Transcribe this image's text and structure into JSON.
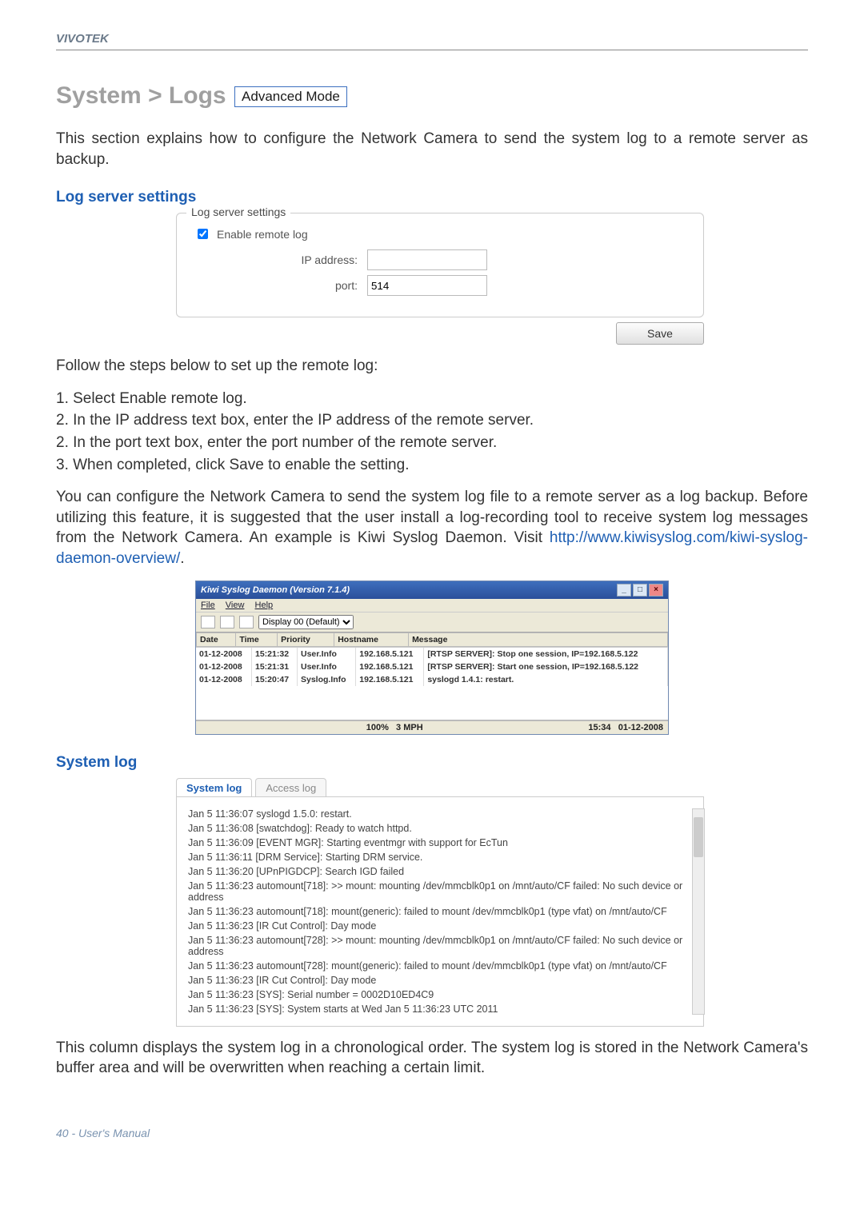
{
  "brand": "VIVOTEK",
  "heading": "System > Logs",
  "advanced_badge": "Advanced Mode",
  "intro_para": "This section explains how to configure the Network Camera to send the system log to a remote server as backup.",
  "section_log_server": "Log server settings",
  "panel": {
    "legend": "Log server settings",
    "enable_label": "Enable remote log",
    "ip_label": "IP address:",
    "ip_value": "",
    "port_label": "port:",
    "port_value": "514",
    "save_label": "Save"
  },
  "steps_intro": "Follow the steps below to set up the remote log:",
  "steps": [
    "1. Select Enable remote log.",
    "2. In the IP address text box, enter the IP address of the remote server.",
    "2. In the port text box, enter the port number of the remote server.",
    "3. When completed, click Save to enable the setting."
  ],
  "backup_para_pre": "You can configure the Network Camera to send the system log file to a remote server as a log backup. Before utilizing this feature, it is suggested that the user install a log-recording tool to receive system log messages from the Network Camera. An example is Kiwi Syslog Daemon. Visit ",
  "backup_link": "http://www.kiwisyslog.com/kiwi-syslog-daemon-overview/",
  "backup_para_post": ".",
  "kiwi": {
    "title": "Kiwi Syslog Daemon (Version 7.1.4)",
    "menu": [
      "File",
      "View",
      "Help"
    ],
    "display_mode": "Display 00 (Default)",
    "headers": [
      "Date",
      "Time",
      "Priority",
      "Hostname",
      "Message"
    ],
    "rows": [
      [
        "01-12-2008",
        "15:21:32",
        "User.Info",
        "192.168.5.121",
        "[RTSP SERVER]: Stop one session, IP=192.168.5.122"
      ],
      [
        "01-12-2008",
        "15:21:31",
        "User.Info",
        "192.168.5.121",
        "[RTSP SERVER]: Start one session, IP=192.168.5.122"
      ],
      [
        "01-12-2008",
        "15:20:47",
        "Syslog.Info",
        "192.168.5.121",
        "syslogd 1.4.1: restart."
      ]
    ],
    "status_left": "100%",
    "status_mid": "3 MPH",
    "status_time": "15:34",
    "status_date": "01-12-2008"
  },
  "section_system_log": "System log",
  "syslog_tabs": {
    "active": "System log",
    "inactive": "Access log"
  },
  "syslog_lines": [
    "Jan 5 11:36:07 syslogd 1.5.0: restart.",
    "Jan 5 11:36:08 [swatchdog]: Ready to watch httpd.",
    "Jan 5 11:36:09 [EVENT MGR]: Starting eventmgr with support for EcTun",
    "Jan 5 11:36:11 [DRM Service]: Starting DRM service.",
    "Jan 5 11:36:20 [UPnPIGDCP]: Search IGD failed",
    "Jan 5 11:36:23 automount[718]: >> mount: mounting /dev/mmcblk0p1 on /mnt/auto/CF failed: No such device or address",
    "Jan 5 11:36:23 automount[718]: mount(generic): failed to mount /dev/mmcblk0p1 (type vfat) on /mnt/auto/CF",
    "Jan 5 11:36:23 [IR Cut Control]: Day mode",
    "Jan 5 11:36:23 automount[728]: >> mount: mounting /dev/mmcblk0p1 on /mnt/auto/CF failed: No such device or address",
    "Jan 5 11:36:23 automount[728]: mount(generic): failed to mount /dev/mmcblk0p1 (type vfat) on /mnt/auto/CF",
    "Jan 5 11:36:23 [IR Cut Control]: Day mode",
    "Jan 5 11:36:23 [SYS]: Serial number = 0002D10ED4C9",
    "Jan 5 11:36:23 [SYS]: System starts at Wed Jan 5 11:36:23 UTC 2011"
  ],
  "syslog_para": "This column displays the system log in a chronological order. The system log is stored in the Network Camera's buffer area and will be overwritten when reaching a certain limit.",
  "footer": "40 - User's Manual"
}
